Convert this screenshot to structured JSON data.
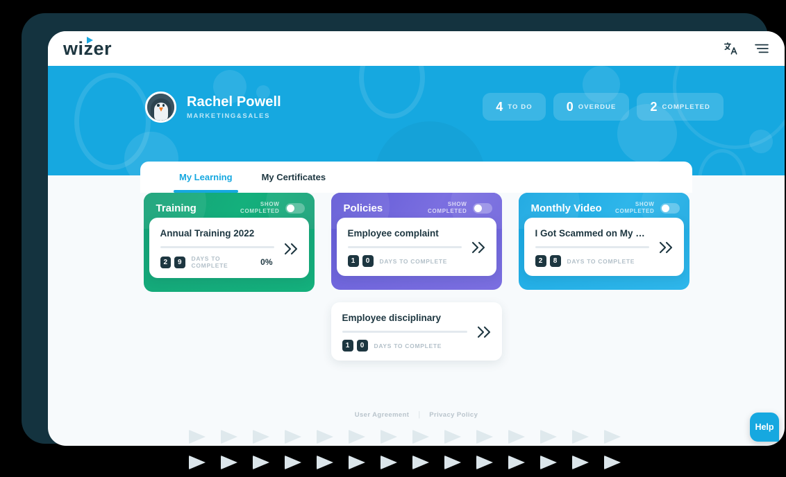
{
  "brand": {
    "logo_text": "wizer",
    "accent_color": "#16a8e0",
    "frame_color": "#14333f"
  },
  "topbar": {
    "icons": [
      {
        "name": "translate-icon",
        "glyph": "文A"
      },
      {
        "name": "hamburger-menu-icon",
        "glyph": "≡"
      }
    ]
  },
  "hero": {
    "profile": {
      "name": "Rachel Powell",
      "department": "MARKETING&SALES",
      "avatar": "penguin-avatar"
    },
    "stats": [
      {
        "value": "4",
        "label": "TO DO"
      },
      {
        "value": "0",
        "label": "OVERDUE"
      },
      {
        "value": "2",
        "label": "COMPLETED"
      }
    ]
  },
  "tabs": [
    {
      "label": "My Learning",
      "active": true
    },
    {
      "label": "My Certificates",
      "active": false
    }
  ],
  "toggle_label": "SHOW\nCOMPLETED",
  "groups": [
    {
      "title": "Training",
      "color": "#16a077",
      "theme": "green",
      "show_completed": false,
      "items": [
        {
          "title": "Annual Training 2022",
          "days": [
            "2",
            "9"
          ],
          "days_label": "DAYS TO COMPLETE",
          "percent": "0%",
          "progress": 0
        }
      ]
    },
    {
      "title": "Policies",
      "color": "#6159d6",
      "theme": "purple",
      "show_completed": false,
      "items": [
        {
          "title": "Employee complaint",
          "days": [
            "1",
            "0"
          ],
          "days_label": "DAYS TO COMPLETE",
          "percent": "",
          "progress": 0
        }
      ],
      "extra_items": [
        {
          "title": "Employee disciplinary",
          "days": [
            "1",
            "0"
          ],
          "days_label": "DAYS TO COMPLETE",
          "percent": "",
          "progress": 0
        }
      ]
    },
    {
      "title": "Monthly Video",
      "color": "#14a5e0",
      "theme": "blue",
      "show_completed": false,
      "items": [
        {
          "title": "I Got Scammed on My Fir...",
          "days": [
            "2",
            "8"
          ],
          "days_label": "DAYS TO COMPLETE",
          "percent": "",
          "progress": 0
        }
      ]
    }
  ],
  "footer": {
    "user_agreement": "User Agreement",
    "separator": "|",
    "privacy_policy": "Privacy Policy"
  },
  "help": {
    "label": "Help"
  },
  "decoration": {
    "triangle_count_top": 14,
    "triangle_count_bottom": 14
  }
}
